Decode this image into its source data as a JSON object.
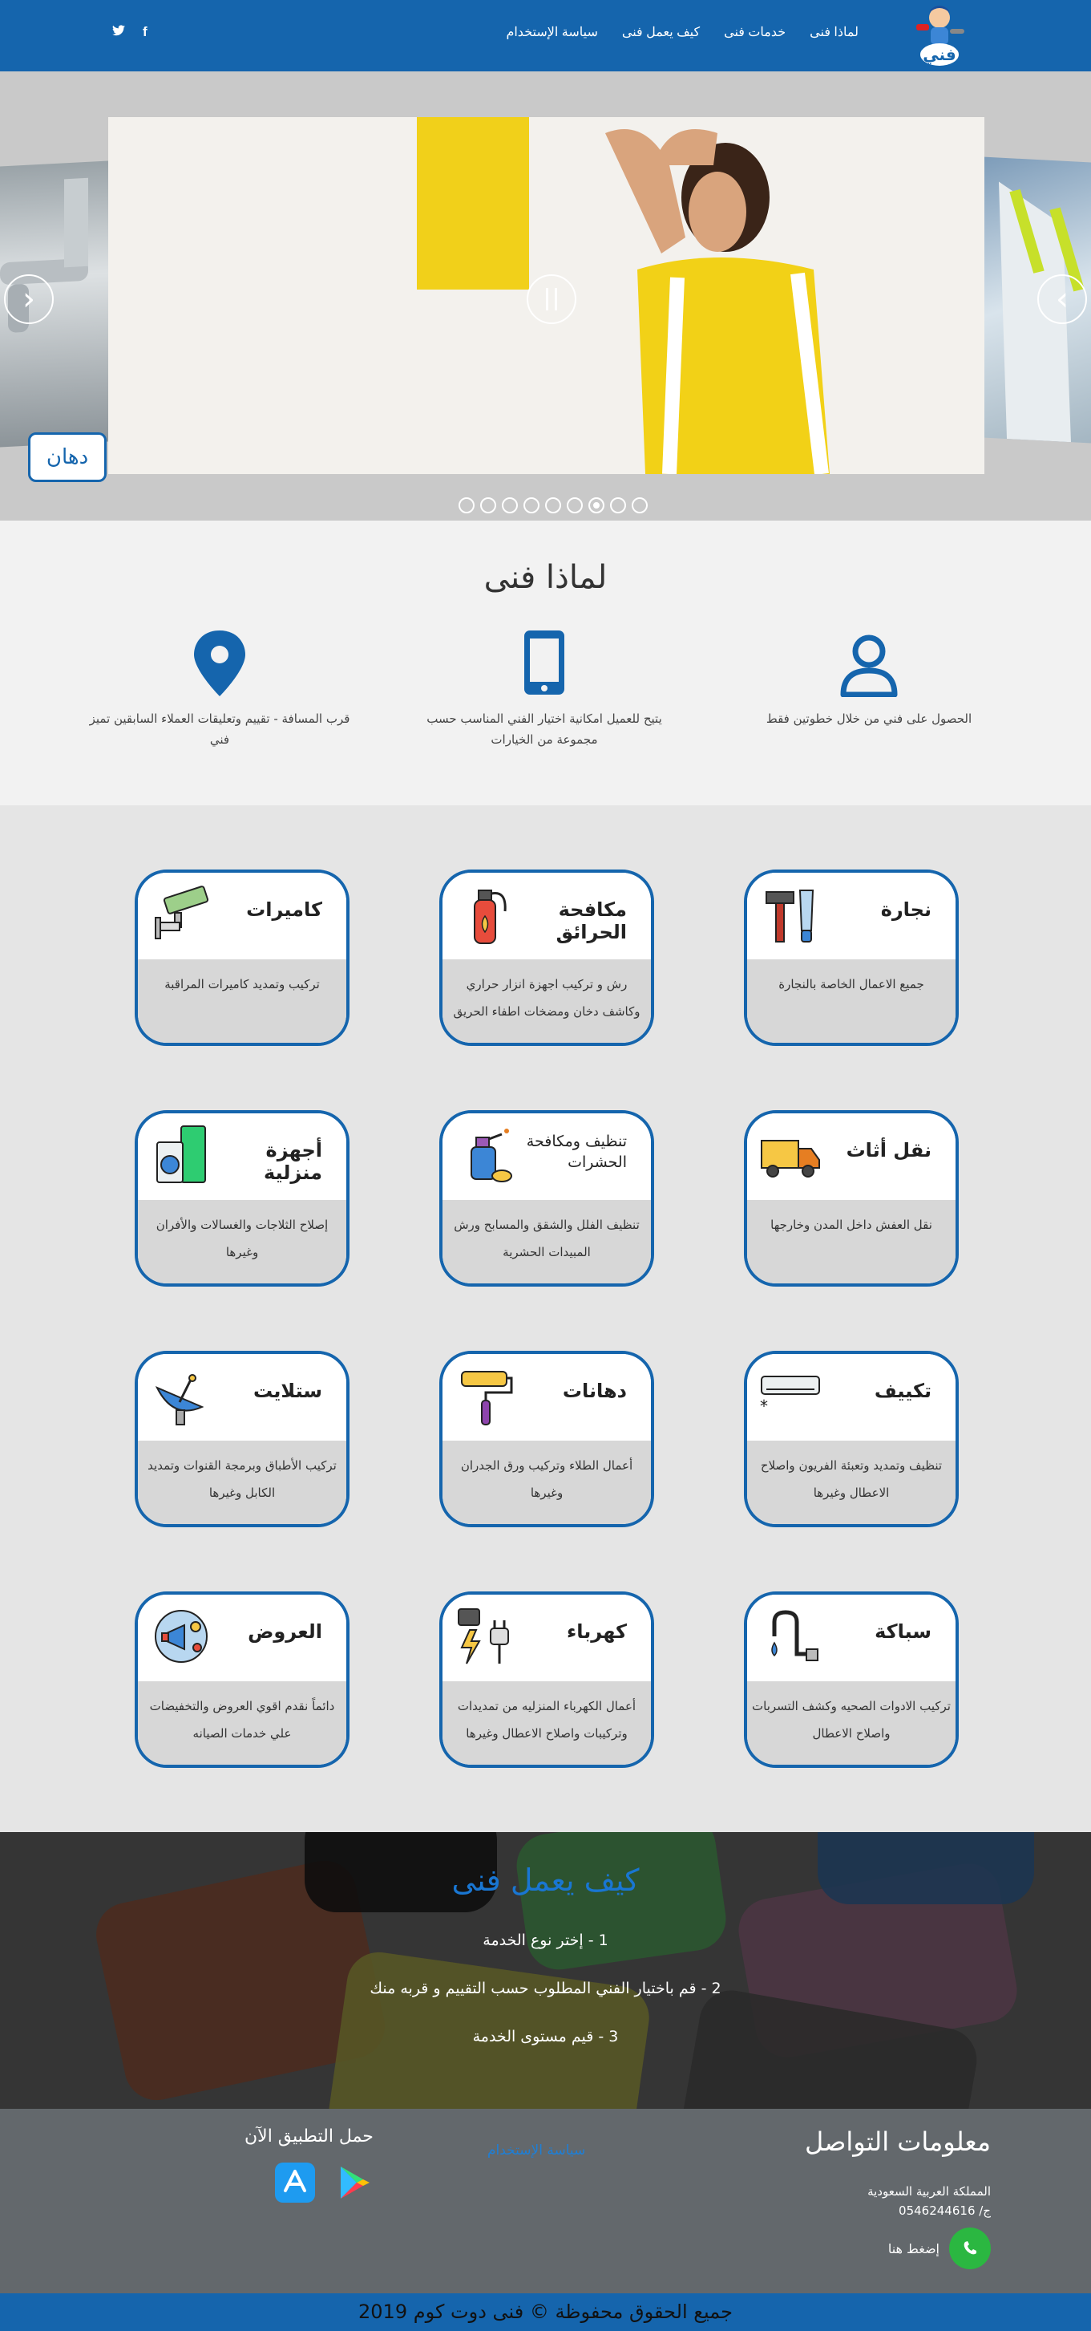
{
  "nav": {
    "menu": [
      {
        "label": "لماذا فنى"
      },
      {
        "label": "خدمات فنى"
      },
      {
        "label": "كيف يعمل فنى"
      },
      {
        "label": "سياسة الإستخدام"
      }
    ],
    "social": [
      {
        "icon": "facebook-icon",
        "glyph": "f"
      },
      {
        "icon": "twitter-icon",
        "glyph": "🐦"
      }
    ],
    "brand_color": "#1565ad"
  },
  "slider": {
    "label": "دهان",
    "prev_arrow": "‹",
    "next_arrow": "›",
    "dots_count": 9,
    "active_dot": 3
  },
  "why": {
    "title": "لماذا فنى",
    "features": [
      {
        "icon": "user-icon",
        "text": "الحصول على فني من خلال خطوتين فقط"
      },
      {
        "icon": "mobile-icon",
        "text": "يتيح للعميل امكانية اختيار الفني المناسب حسب مجموعة من الخيارات"
      },
      {
        "icon": "location-pin-icon",
        "text": "قرب المسافة - تقييم وتعليقات العملاء السابقين تميز فني"
      }
    ]
  },
  "services": [
    {
      "title": "نجارة",
      "desc": "جميع الاعمال الخاصة بالنجارة",
      "icon": "carpentry-tools-icon"
    },
    {
      "title": "مكافحة الحرائق",
      "desc": "رش و تركيب اجهزة انزار حراري وكاشف دخان ومضخات اطفاء الحريق",
      "icon": "fire-extinguisher-icon"
    },
    {
      "title": "كاميرات",
      "desc": "تركيب وتمديد كاميرات المراقبة",
      "icon": "security-camera-icon"
    },
    {
      "title": "نقل أثاث",
      "desc": "نقل العفش داخل المدن وخارجها",
      "icon": "truck-icon"
    },
    {
      "title": "تنظيف ومكافحة الحشرات",
      "desc": "تنظيف الفلل والشقق والمسابح ورش المبيدات الحشرية",
      "icon": "cleaning-spray-icon"
    },
    {
      "title": "أجهزة منزلية",
      "desc": "إصلاح الثلاجات والغسالات والأفران وغيرها",
      "icon": "home-appliances-icon"
    },
    {
      "title": "تكييف",
      "desc": "تنظيف وتمديد وتعبئة الفريون واصلاح الاعطال وغيرها",
      "icon": "air-conditioner-icon"
    },
    {
      "title": "دهانات",
      "desc": "أعمال الطلاء وتركيب ورق الجدران وغيرها",
      "icon": "paint-roller-icon"
    },
    {
      "title": "ستلايت",
      "desc": "تركيب الأطباق وبرمجة القنوات وتمديد الكابل وغيرها",
      "icon": "satellite-dish-icon"
    },
    {
      "title": "سباكة",
      "desc": "تركيب الادوات الصحيه وكشف التسربات واصلاح الاعطال",
      "icon": "faucet-icon"
    },
    {
      "title": "كهرباء",
      "desc": "أعمال الكهرباء المنزليه من تمديدات وتركيبات واصلاح الاعطال وغيرها",
      "icon": "electric-plug-icon"
    },
    {
      "title": "العروض",
      "desc": "دائماً نقدم اقوي العروض والتخفيضات علي خدمات الصيانه",
      "icon": "offers-megaphone-icon"
    }
  ],
  "how": {
    "title": "كيف يعمل فنى",
    "steps": [
      "1 - إختر نوع الخدمة",
      "2 - قم باختيار الفني المطلوب حسب التقييم و قربه منك",
      "3 - قيم مستوى الخدمة"
    ]
  },
  "contact": {
    "title": "معلومات التواصل",
    "country": "المملكة العربية السعودية",
    "phone": "ج/ 0546244616",
    "whatsapp_label": "إضغط هنا",
    "privacy_link": "سياسة الإستخدام",
    "download_title": "حمل التطبيق الآن",
    "stores": [
      "app-store-icon",
      "google-play-icon"
    ]
  },
  "footer": {
    "copyright": "جميع الحقوق محفوظة © فنى دوت كوم 2019"
  }
}
